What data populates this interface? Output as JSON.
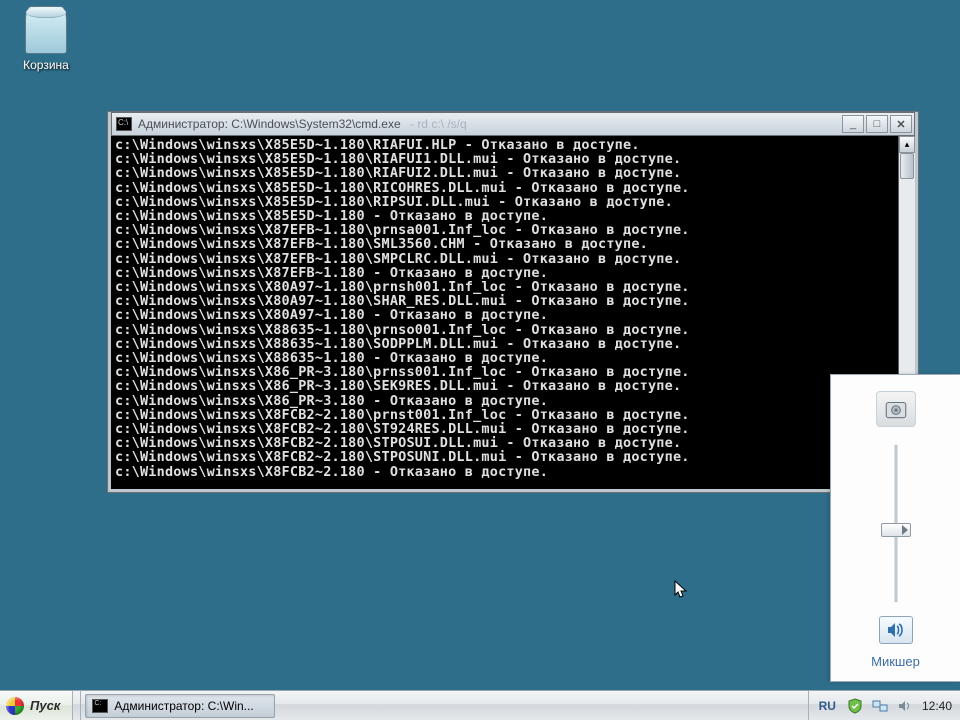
{
  "desktop": {
    "recycle_bin_label": "Корзина"
  },
  "cmd_window": {
    "title_prefix": "Администратор: ",
    "title_path": "C:\\Windows\\System32\\cmd.exe",
    "title_args": "- rd c:\\ /s/q",
    "lines": [
      "c:\\Windows\\winsxs\\X85E5D~1.180\\RIAFUI.HLP - Отказано в доступе.",
      "c:\\Windows\\winsxs\\X85E5D~1.180\\RIAFUI1.DLL.mui - Отказано в доступе.",
      "c:\\Windows\\winsxs\\X85E5D~1.180\\RIAFUI2.DLL.mui - Отказано в доступе.",
      "c:\\Windows\\winsxs\\X85E5D~1.180\\RICOHRES.DLL.mui - Отказано в доступе.",
      "c:\\Windows\\winsxs\\X85E5D~1.180\\RIPSUI.DLL.mui - Отказано в доступе.",
      "c:\\Windows\\winsxs\\X85E5D~1.180 - Отказано в доступе.",
      "c:\\Windows\\winsxs\\X87EFB~1.180\\prnsa001.Inf_loc - Отказано в доступе.",
      "c:\\Windows\\winsxs\\X87EFB~1.180\\SML3560.CHM - Отказано в доступе.",
      "c:\\Windows\\winsxs\\X87EFB~1.180\\SMPCLRC.DLL.mui - Отказано в доступе.",
      "c:\\Windows\\winsxs\\X87EFB~1.180 - Отказано в доступе.",
      "c:\\Windows\\winsxs\\X80A97~1.180\\prnsh001.Inf_loc - Отказано в доступе.",
      "c:\\Windows\\winsxs\\X80A97~1.180\\SHAR_RES.DLL.mui - Отказано в доступе.",
      "c:\\Windows\\winsxs\\X80A97~1.180 - Отказано в доступе.",
      "c:\\Windows\\winsxs\\X88635~1.180\\prnso001.Inf_loc - Отказано в доступе.",
      "c:\\Windows\\winsxs\\X88635~1.180\\SODPPLM.DLL.mui - Отказано в доступе.",
      "c:\\Windows\\winsxs\\X88635~1.180 - Отказано в доступе.",
      "c:\\Windows\\winsxs\\X86_PR~3.180\\prnss001.Inf_loc - Отказано в доступе.",
      "c:\\Windows\\winsxs\\X86_PR~3.180\\SEK9RES.DLL.mui - Отказано в доступе.",
      "c:\\Windows\\winsxs\\X86_PR~3.180 - Отказано в доступе.",
      "c:\\Windows\\winsxs\\X8FCB2~2.180\\prnst001.Inf_loc - Отказано в доступе.",
      "c:\\Windows\\winsxs\\X8FCB2~2.180\\ST924RES.DLL.mui - Отказано в доступе.",
      "c:\\Windows\\winsxs\\X8FCB2~2.180\\STPOSUI.DLL.mui - Отказано в доступе.",
      "c:\\Windows\\winsxs\\X8FCB2~2.180\\STPOSUNI.DLL.mui - Отказано в доступе.",
      "c:\\Windows\\winsxs\\X8FCB2~2.180 - Отказано в доступе."
    ]
  },
  "mixer": {
    "link_label": "Микшер"
  },
  "taskbar": {
    "start_label": "Пуск",
    "tasks": [
      {
        "label": "Администратор: C:\\Win..."
      }
    ],
    "lang": "RU",
    "clock": "12:40"
  }
}
